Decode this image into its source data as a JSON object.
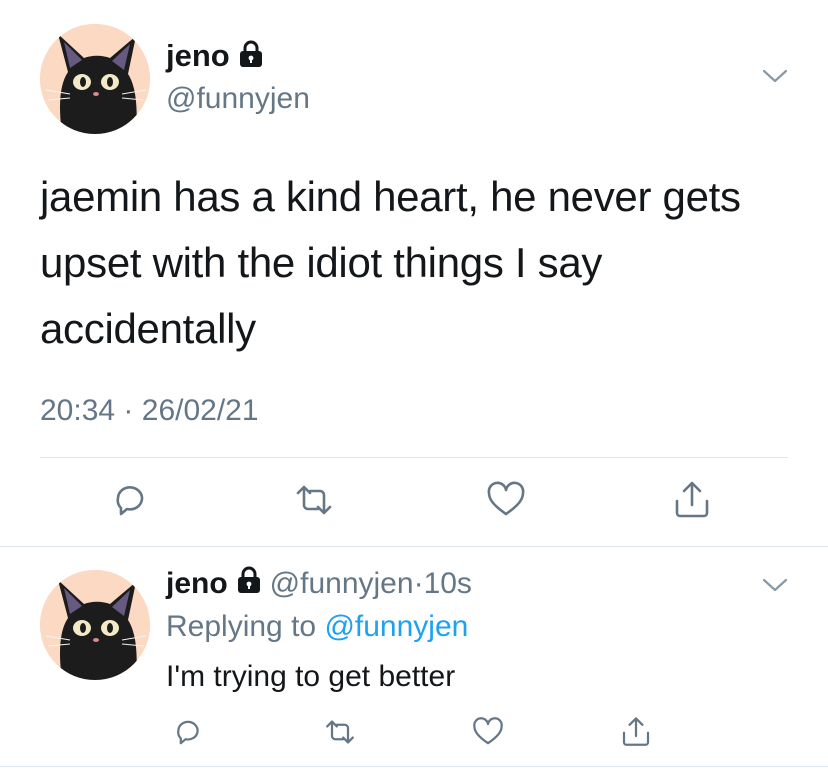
{
  "main_tweet": {
    "name": "jeno",
    "handle": "@funnyjen",
    "text": "jaemin has a kind heart, he never gets upset with the idiot things I say accidentally",
    "time": "20:34",
    "separator": "·",
    "date": "26/02/21"
  },
  "reply_tweet": {
    "name": "jeno",
    "handle": "@funnyjen",
    "dot": "·",
    "age": "10s",
    "replying_prefix": "Replying to",
    "replying_to": "@funnyjen",
    "text": "I'm trying to get better"
  },
  "icons": {
    "lock": "lock-icon",
    "chevron": "chevron-down-icon",
    "reply": "reply-icon",
    "retweet": "retweet-icon",
    "like": "heart-icon",
    "share": "share-icon"
  },
  "colors": {
    "text": "#14171a",
    "secondary": "#657786",
    "link": "#1da1f2",
    "divider": "#e1e8ed",
    "avatar_bg": "#fbd9c2"
  }
}
